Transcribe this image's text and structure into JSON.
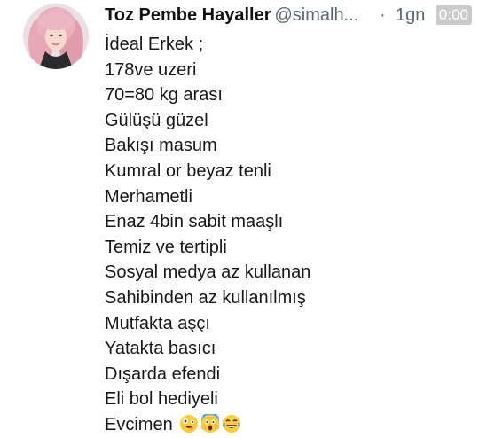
{
  "tweet": {
    "author": {
      "display_name": "Toz Pembe Hayaller",
      "handle": "@simalh...",
      "avatar_icon": "profile-photo-pink-hair"
    },
    "separator": "·",
    "time": "1gn",
    "video_duration": "0:00",
    "lines": [
      "İdeal Erkek ;",
      "178ve uzeri",
      "70=80 kg arası",
      "Gülüşü güzel",
      "Bakışı masum",
      "Kumral or beyaz tenli",
      "Merhametli",
      "Enaz 4bin sabit maaşlı",
      "Temiz ve tertipli",
      "Sosyal medya az kullanan",
      "Sahibinden az kullanılmış",
      "Mutfakta aşçı",
      "Yatakta basıcı",
      "Dışarda efendi",
      "Eli bol hediyeli",
      "Evcimen"
    ],
    "last_line_emojis": [
      "zany-face-emoji",
      "screaming-face-emoji",
      "tears-of-joy-emoji"
    ]
  }
}
